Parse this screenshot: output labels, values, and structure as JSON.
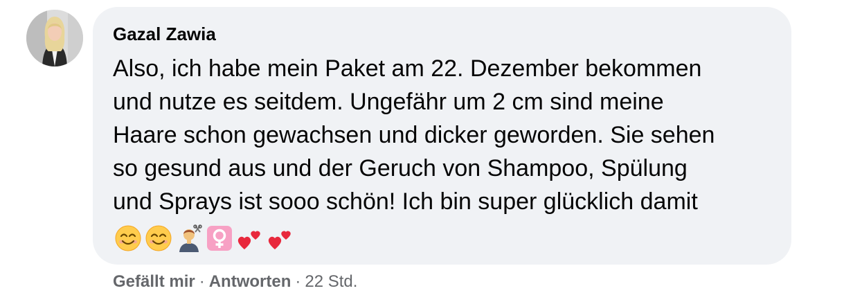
{
  "comment": {
    "author": "Gazal Zawia",
    "lines": [
      "Also, ich habe mein Paket am 22. Dezember bekommen",
      "und nutze es seitdem. Ungefähr um 2 cm sind meine",
      "Haare schon gewachsen und dicker geworden. Sie sehen",
      "so gesund aus und der Geruch von Shampoo, Spülung",
      "und Sprays ist sooo schön! Ich bin super glücklich damit"
    ],
    "emojis": [
      "smiling-face-with-smiling-eyes-icon",
      "smiling-face-with-smiling-eyes-icon",
      "person-getting-haircut-icon",
      "female-sign-icon",
      "two-hearts-icon",
      "two-hearts-icon"
    ]
  },
  "actions": {
    "like_label": "Gefällt mir",
    "separator": "·",
    "reply_label": "Antworten",
    "timestamp": "22 Std."
  },
  "colors": {
    "bubble_background": "#f0f2f5",
    "text": "#050505",
    "meta_text": "#65676b"
  }
}
